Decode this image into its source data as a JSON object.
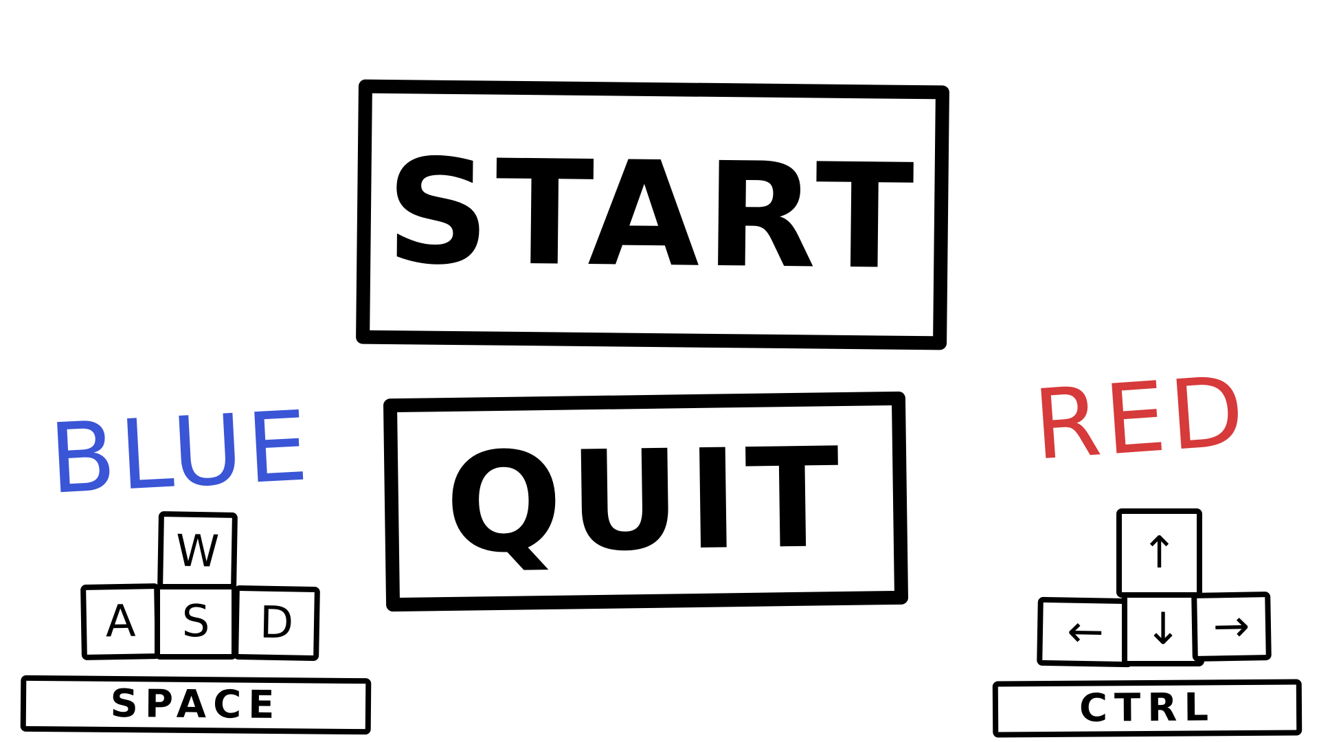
{
  "menu": {
    "start_label": "START",
    "quit_label": "QUIT"
  },
  "players": {
    "blue": {
      "name": "BLUE",
      "color": "#3a55d6",
      "keys": {
        "up": "W",
        "left": "A",
        "down": "S",
        "right": "D",
        "action": "SPACE"
      }
    },
    "red": {
      "name": "RED",
      "color": "#d63a3a",
      "keys": {
        "up": "↑",
        "left": "←",
        "down": "↓",
        "right": "→",
        "action": "CTRL"
      }
    }
  }
}
